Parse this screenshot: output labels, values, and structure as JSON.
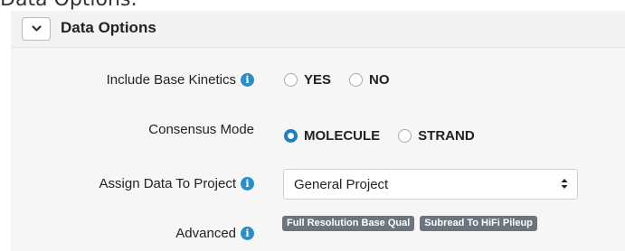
{
  "page_heading_partial": "Data Options:",
  "section": {
    "title": "Data Options",
    "collapse_icon": "chevron-down-icon"
  },
  "fields": {
    "base_kinetics": {
      "label": "Include Base Kinetics",
      "options": [
        "YES",
        "NO"
      ],
      "selected": null
    },
    "consensus_mode": {
      "label": "Consensus Mode",
      "options": [
        "MOLECULE",
        "STRAND"
      ],
      "selected": "MOLECULE"
    },
    "project": {
      "label": "Assign Data To Project",
      "value": "General Project"
    },
    "advanced": {
      "label": "Advanced",
      "tags": [
        "Full Resolution Base Qual",
        "Subread To HiFi Pileup"
      ]
    }
  },
  "colors": {
    "accent": "#1c7fc0",
    "info_icon": "#2b8fc5",
    "tag_bg": "#6c757d",
    "panel_bg": "#f6f6f6"
  }
}
